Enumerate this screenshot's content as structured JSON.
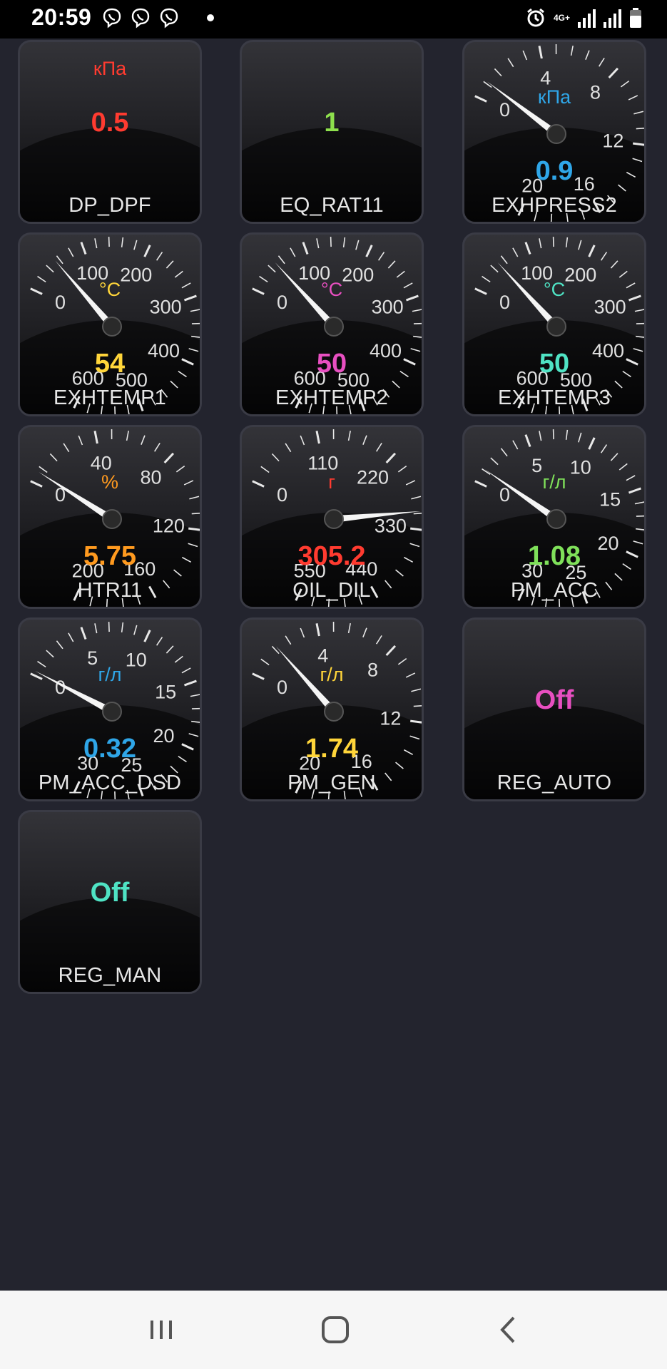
{
  "status": {
    "time": "20:59",
    "network": "4G+"
  },
  "tiles": [
    {
      "name": "DP_DPF",
      "type": "digital",
      "unit": "кПа",
      "value": "0.5",
      "color": "#ff3b30"
    },
    {
      "name": "EQ_RAT11",
      "type": "digital",
      "unit": "",
      "value": "1",
      "color": "#8ee04d"
    },
    {
      "name": "EXHPRESS2",
      "type": "gauge",
      "unit": "кПа",
      "value": "0.9",
      "color": "#2fa6e8",
      "ticks": [
        "0",
        "4",
        "8",
        "12",
        "16",
        "20"
      ],
      "max": 20,
      "reading": 0.9
    },
    {
      "name": "EXHTEMP1",
      "type": "gauge",
      "unit": "°C",
      "value": "54",
      "color": "#ffd53a",
      "ticks": [
        "0",
        "100",
        "200",
        "300",
        "400",
        "500",
        "600"
      ],
      "max": 600,
      "reading": 54
    },
    {
      "name": "EXHTEMP2",
      "type": "gauge",
      "unit": "°C",
      "value": "50",
      "color": "#e84fc1",
      "ticks": [
        "0",
        "100",
        "200",
        "300",
        "400",
        "500",
        "600"
      ],
      "max": 600,
      "reading": 50
    },
    {
      "name": "EXHTEMP3",
      "type": "gauge",
      "unit": "°C",
      "value": "50",
      "color": "#4fe3c4",
      "ticks": [
        "0",
        "100",
        "200",
        "300",
        "400",
        "500",
        "600"
      ],
      "max": 600,
      "reading": 50
    },
    {
      "name": "HTR11",
      "type": "gauge",
      "unit": "%",
      "value": "5.75",
      "color": "#ff9a1f",
      "ticks": [
        "0",
        "40",
        "80",
        "120",
        "160",
        "200"
      ],
      "max": 200,
      "reading": 5.75
    },
    {
      "name": "OIL_DIL",
      "type": "gauge",
      "unit": "г",
      "value": "305.2",
      "color": "#ff3b30",
      "ticks": [
        "0",
        "110",
        "220",
        "330",
        "440",
        "550"
      ],
      "max": 550,
      "reading": 305.2
    },
    {
      "name": "PM_ACC",
      "type": "gauge",
      "unit": "г/л",
      "value": "1.08",
      "color": "#7fe05a",
      "ticks": [
        "0",
        "5",
        "10",
        "15",
        "20",
        "25",
        "30"
      ],
      "max": 30,
      "reading": 1.08
    },
    {
      "name": "PM_ACC_DSD",
      "type": "gauge",
      "unit": "г/л",
      "value": "0.32",
      "color": "#2fa6e8",
      "ticks": [
        "0",
        "5",
        "10",
        "15",
        "20",
        "25",
        "30"
      ],
      "max": 30,
      "reading": 0.32
    },
    {
      "name": "PM_GEN",
      "type": "gauge",
      "unit": "г/л",
      "value": "1.74",
      "color": "#ffd53a",
      "ticks": [
        "0",
        "4",
        "8",
        "12",
        "16",
        "20"
      ],
      "max": 20,
      "reading": 1.74
    },
    {
      "name": "REG_AUTO",
      "type": "digital",
      "unit": "",
      "value": "Off",
      "color": "#e84fc1"
    },
    {
      "name": "REG_MAN",
      "type": "digital",
      "unit": "",
      "value": "Off",
      "color": "#4fe3c4"
    }
  ],
  "icons": {
    "status": [
      "viber-icon",
      "viber-icon",
      "viber-icon",
      "dot-icon",
      "alarm-icon",
      "signal-icon",
      "signal-icon",
      "battery-icon"
    ],
    "nav": [
      "recent-apps-icon",
      "home-icon",
      "back-icon"
    ]
  }
}
